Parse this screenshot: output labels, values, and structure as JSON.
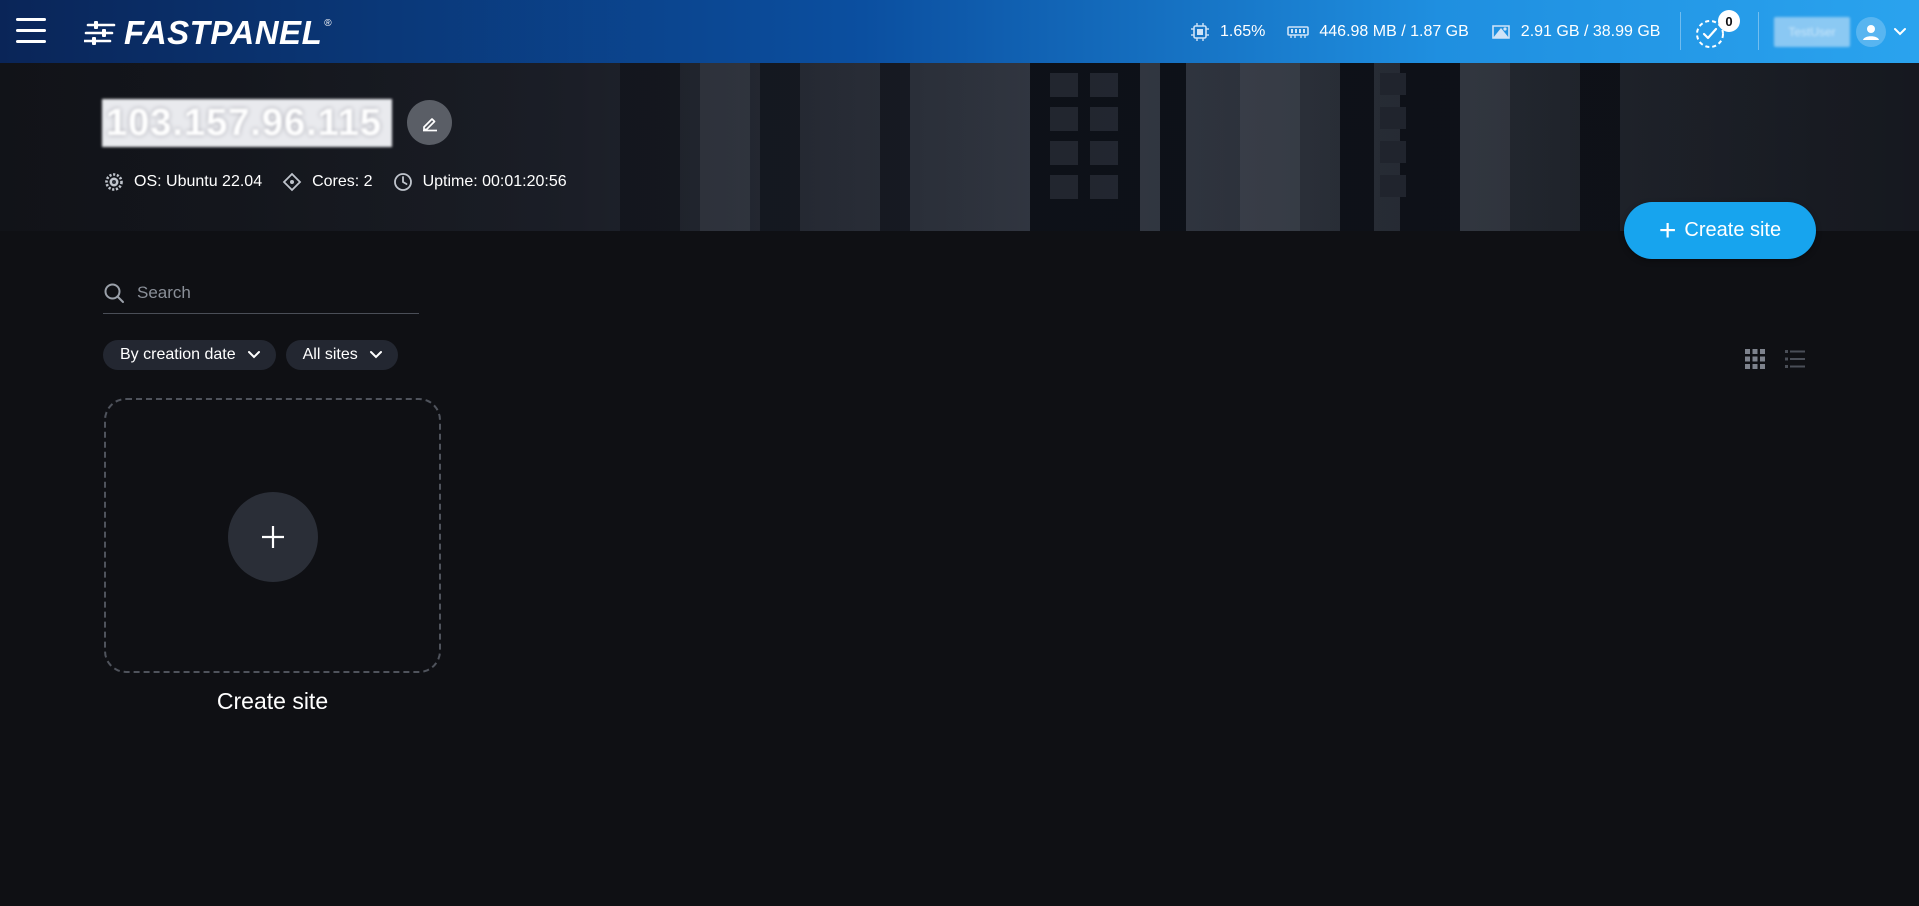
{
  "header": {
    "logo_text": "FASTPANEL",
    "logo_reg": "®",
    "cpu": "1.65%",
    "memory": "446.98 MB / 1.87 GB",
    "disk": "2.91 GB / 38.99 GB",
    "tasks_count": "0",
    "user_name": "TestUser"
  },
  "server": {
    "name": "103.157.96.115",
    "os": "OS: Ubuntu 22.04",
    "cores": "Cores: 2",
    "uptime": "Uptime: 00:01:20:56"
  },
  "actions": {
    "create_site_label": "Create site"
  },
  "search": {
    "placeholder": "Search"
  },
  "filters": {
    "sort": "By creation date",
    "scope": "All sites"
  },
  "card": {
    "label": "Create site"
  },
  "colors": {
    "accent": "#17a4ee",
    "background": "#0f1014"
  }
}
